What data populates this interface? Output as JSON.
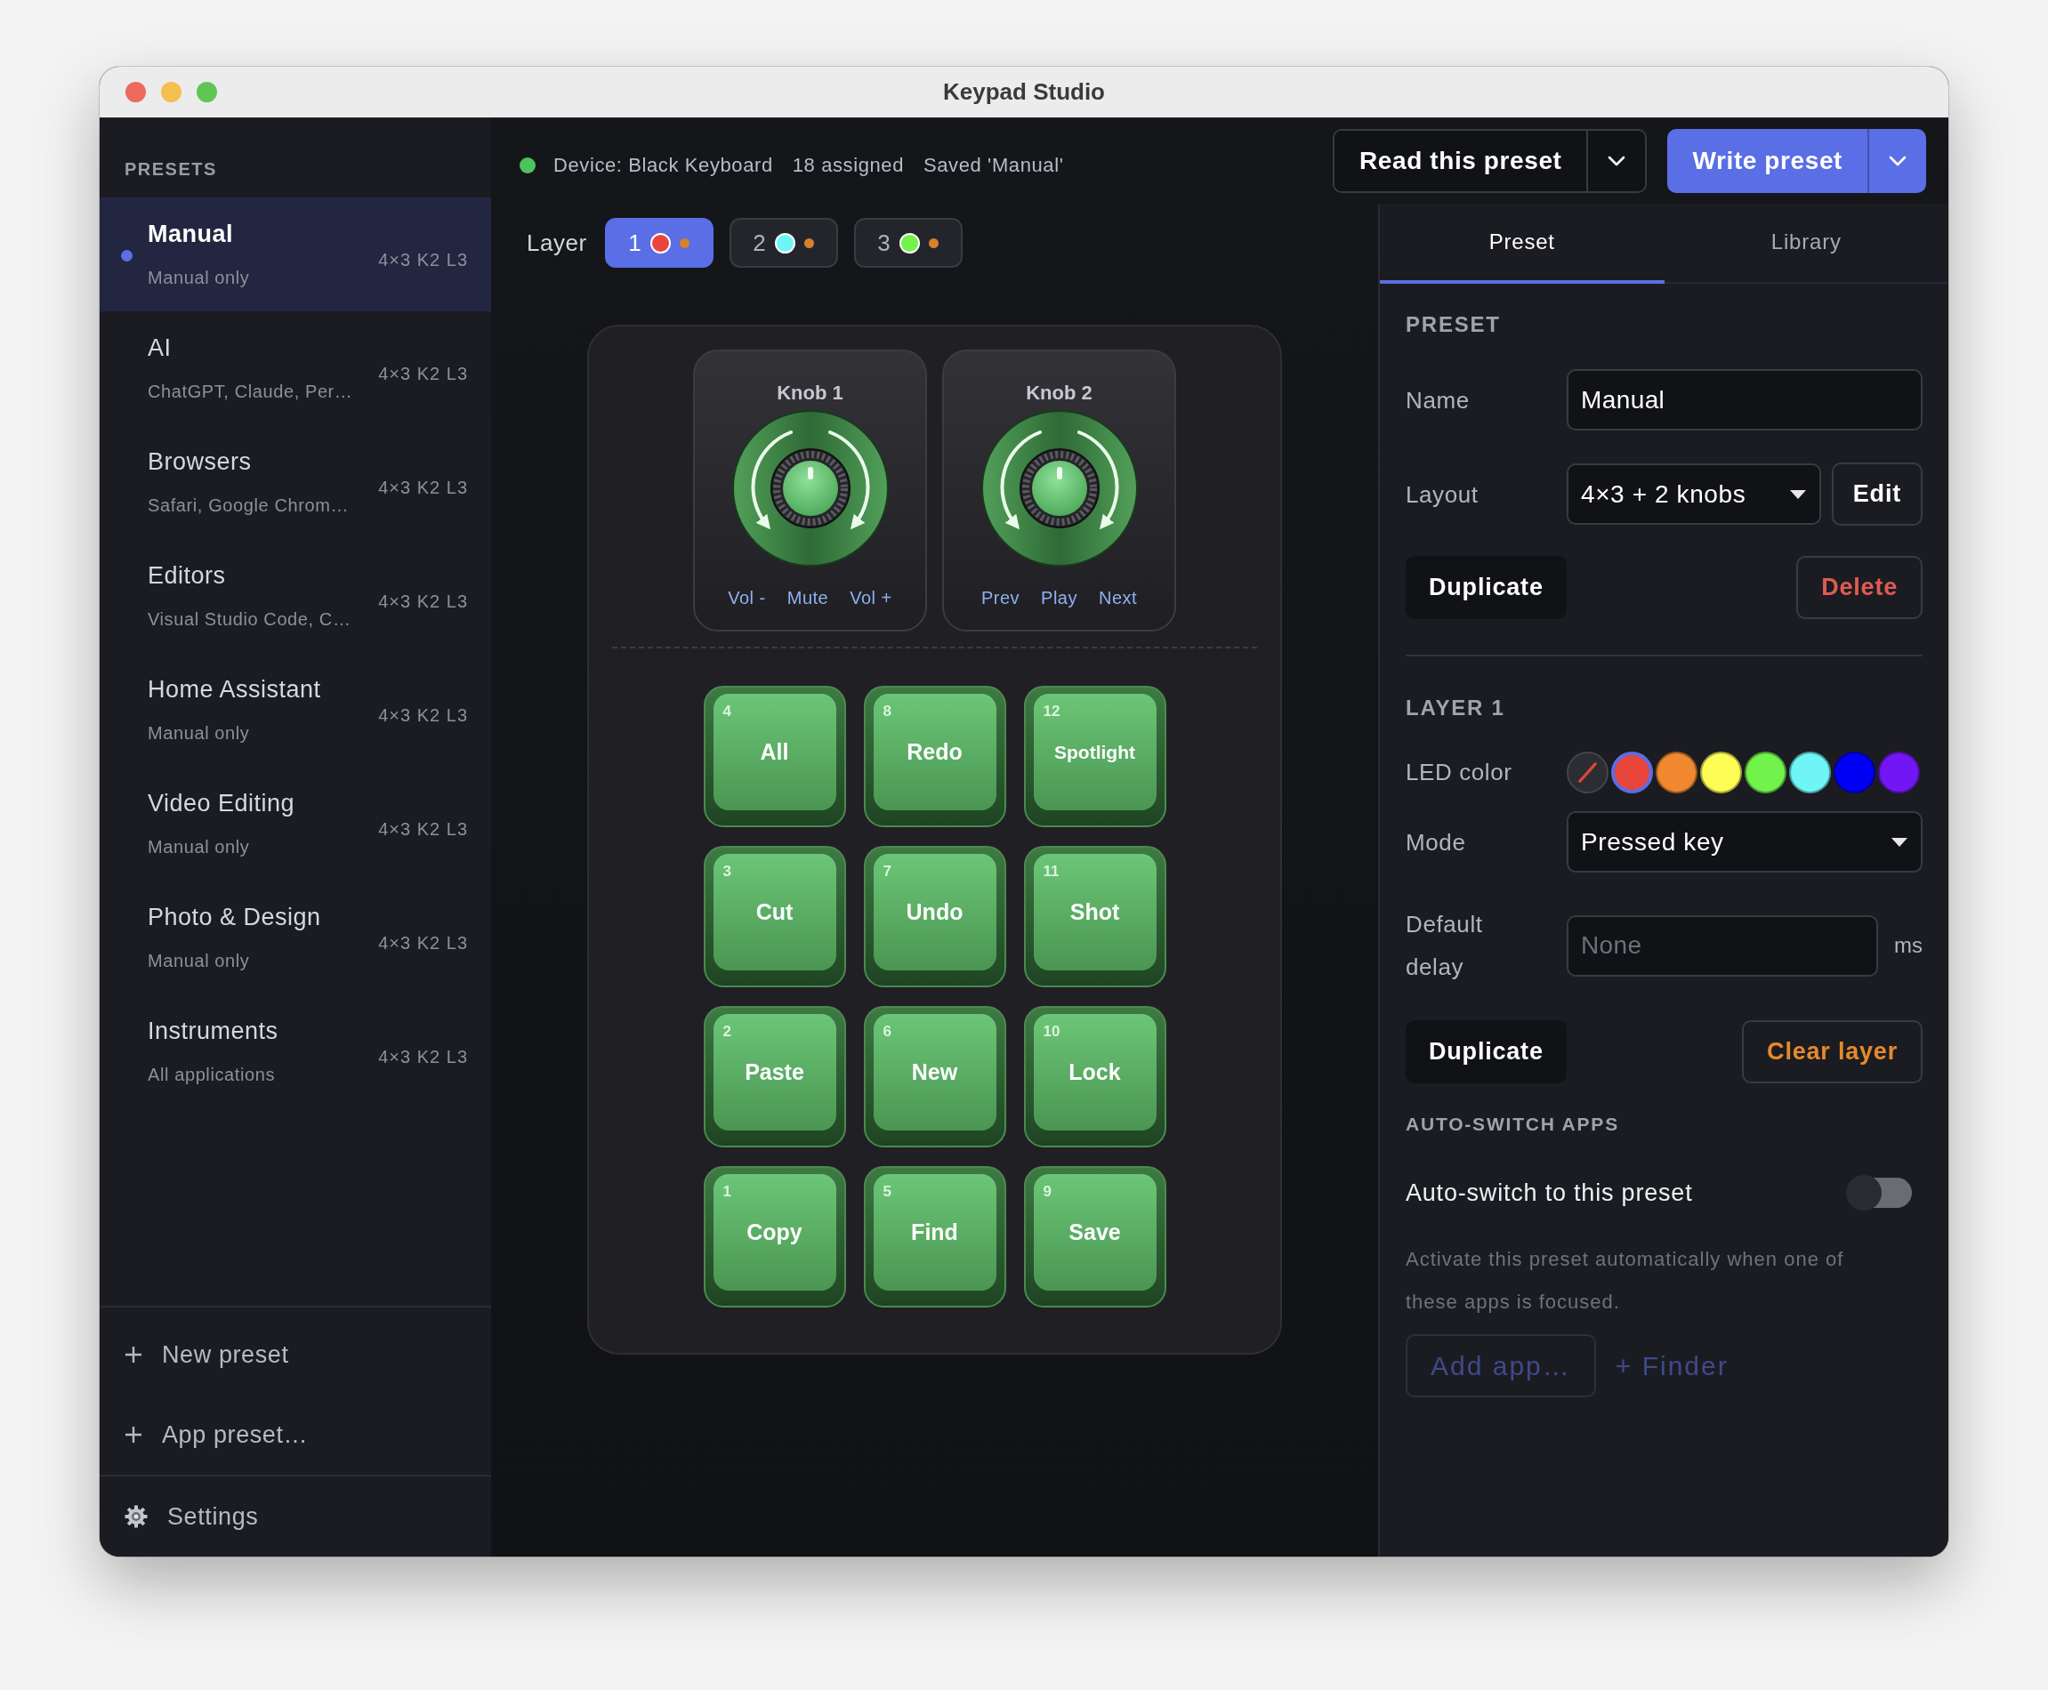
{
  "window": {
    "title": "Keypad Studio"
  },
  "sidebar": {
    "heading": "PRESETS",
    "items": [
      {
        "name": "Manual",
        "subtitle": "Manual only",
        "meta": "4×3 K2 L3",
        "selected": true
      },
      {
        "name": "AI",
        "subtitle": "ChatGPT, Claude, Per…",
        "meta": "4×3 K2 L3",
        "selected": false
      },
      {
        "name": "Browsers",
        "subtitle": "Safari, Google Chrom…",
        "meta": "4×3 K2 L3",
        "selected": false
      },
      {
        "name": "Editors",
        "subtitle": "Visual Studio Code, C…",
        "meta": "4×3 K2 L3",
        "selected": false
      },
      {
        "name": "Home Assistant",
        "subtitle": "Manual only",
        "meta": "4×3 K2 L3",
        "selected": false
      },
      {
        "name": "Video Editing",
        "subtitle": "Manual only",
        "meta": "4×3 K2 L3",
        "selected": false
      },
      {
        "name": "Photo & Design",
        "subtitle": "Manual only",
        "meta": "4×3 K2 L3",
        "selected": false
      },
      {
        "name": "Instruments",
        "subtitle": "All applications",
        "meta": "4×3 K2 L3",
        "selected": false
      }
    ],
    "actions": [
      "New preset",
      "App preset…"
    ],
    "settings": "Settings"
  },
  "status": {
    "connected": true,
    "device": "Device: Black Keyboard",
    "assigned": "18 assigned",
    "saved": "Saved 'Manual'"
  },
  "toolbar": {
    "read_button": "Read this preset",
    "write_button": "Write preset"
  },
  "layers": {
    "label": "Layer",
    "items": [
      {
        "number": "1",
        "selected": true,
        "color": "#e8453c"
      },
      {
        "number": "2",
        "selected": false,
        "color": "#6ff5f5"
      },
      {
        "number": "3",
        "selected": false,
        "color": "#72f24a"
      }
    ]
  },
  "knobs": [
    {
      "title": "Knob 1",
      "actions": [
        "Vol -",
        "Mute",
        "Vol +"
      ]
    },
    {
      "title": "Knob 2",
      "actions": [
        "Prev",
        "Play",
        "Next"
      ]
    }
  ],
  "keys": [
    {
      "number": "4",
      "label": "All"
    },
    {
      "number": "8",
      "label": "Redo"
    },
    {
      "number": "12",
      "label": "Spotlight"
    },
    {
      "number": "3",
      "label": "Cut"
    },
    {
      "number": "7",
      "label": "Undo"
    },
    {
      "number": "11",
      "label": "Shot"
    },
    {
      "number": "2",
      "label": "Paste"
    },
    {
      "number": "6",
      "label": "New"
    },
    {
      "number": "10",
      "label": "Lock"
    },
    {
      "number": "1",
      "label": "Copy"
    },
    {
      "number": "5",
      "label": "Find"
    },
    {
      "number": "9",
      "label": "Save"
    }
  ],
  "panel": {
    "tabs": [
      {
        "label": "Preset",
        "selected": true
      },
      {
        "label": "Library",
        "selected": false
      }
    ],
    "preset": {
      "heading": "PRESET",
      "name_label": "Name",
      "name_value": "Manual",
      "layout_label": "Layout",
      "layout_value": "4×3 + 2 knobs",
      "edit_button": "Edit",
      "duplicate_button": "Duplicate",
      "delete_button": "Delete"
    },
    "layer": {
      "heading": "LAYER 1",
      "led_label": "LED color",
      "swatches": [
        {
          "kind": "none",
          "selected": false
        },
        {
          "kind": "color",
          "color": "#e8453c",
          "selected": true
        },
        {
          "kind": "color",
          "color": "#f0882f",
          "selected": false
        },
        {
          "kind": "color",
          "color": "#fdfd55",
          "selected": false
        },
        {
          "kind": "color",
          "color": "#72f24a",
          "selected": false
        },
        {
          "kind": "color",
          "color": "#6ff5f5",
          "selected": false
        },
        {
          "kind": "color",
          "color": "#0000f5",
          "selected": false
        },
        {
          "kind": "color",
          "color": "#7316f5",
          "selected": false
        }
      ],
      "mode_label": "Mode",
      "mode_value": "Pressed key",
      "delay_label": "Default delay",
      "delay_placeholder": "None",
      "delay_unit": "ms",
      "duplicate_button": "Duplicate",
      "clear_button": "Clear layer"
    },
    "auto_switch": {
      "heading": "AUTO-SWITCH APPS",
      "toggle_label": "Auto-switch to this preset",
      "on": false,
      "description": "Activate this preset automatically when one of these apps is focused.",
      "add_button": {
        "label": "Add app…",
        "disabled": true
      },
      "finder_link": {
        "label": "+ Finder",
        "disabled": true
      }
    }
  }
}
